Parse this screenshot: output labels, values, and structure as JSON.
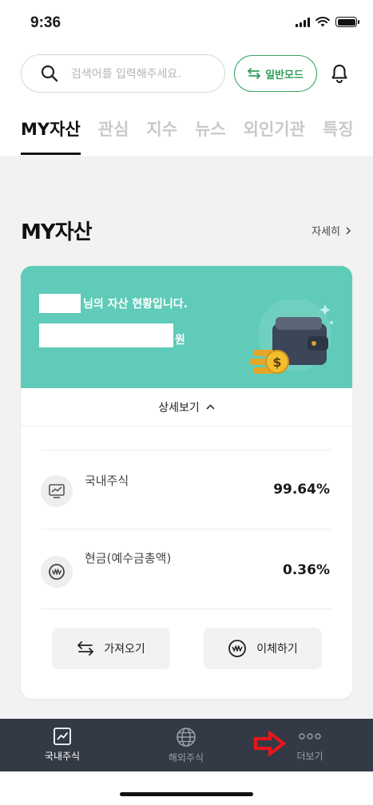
{
  "status_bar": {
    "time": "9:36"
  },
  "search": {
    "placeholder": "검색어를 입력해주세요."
  },
  "mode_button": {
    "label": "일반모드"
  },
  "tabs": [
    "MY자산",
    "관심",
    "지수",
    "뉴스",
    "외인기관",
    "특징"
  ],
  "section": {
    "title": "MY자산",
    "detail_link": "자세히"
  },
  "card": {
    "owner_suffix": "님의 자산 현황입니다.",
    "currency": "원",
    "toggle_label": "상세보기",
    "rows": [
      {
        "label": "국내주식",
        "value": "99.64%",
        "icon": "chart-icon"
      },
      {
        "label": "현금(예수금총액)",
        "value": "0.36%",
        "icon": "won-coin-icon"
      }
    ],
    "actions": [
      {
        "label": "가져오기",
        "icon": "swap-arrows-icon"
      },
      {
        "label": "이체하기",
        "icon": "won-coin-icon"
      }
    ]
  },
  "bottom_nav": [
    {
      "label": "국내주식",
      "icon": "chart-icon",
      "active": true
    },
    {
      "label": "해외주식",
      "icon": "globe-icon",
      "active": false
    },
    {
      "label": "더보기",
      "icon": "more-dots-icon",
      "active": false
    }
  ],
  "colors": {
    "accent_green": "#33a55f",
    "card_teal": "#5fcbb8",
    "nav_bg": "#333a46",
    "annotation_red": "#e8151b"
  }
}
